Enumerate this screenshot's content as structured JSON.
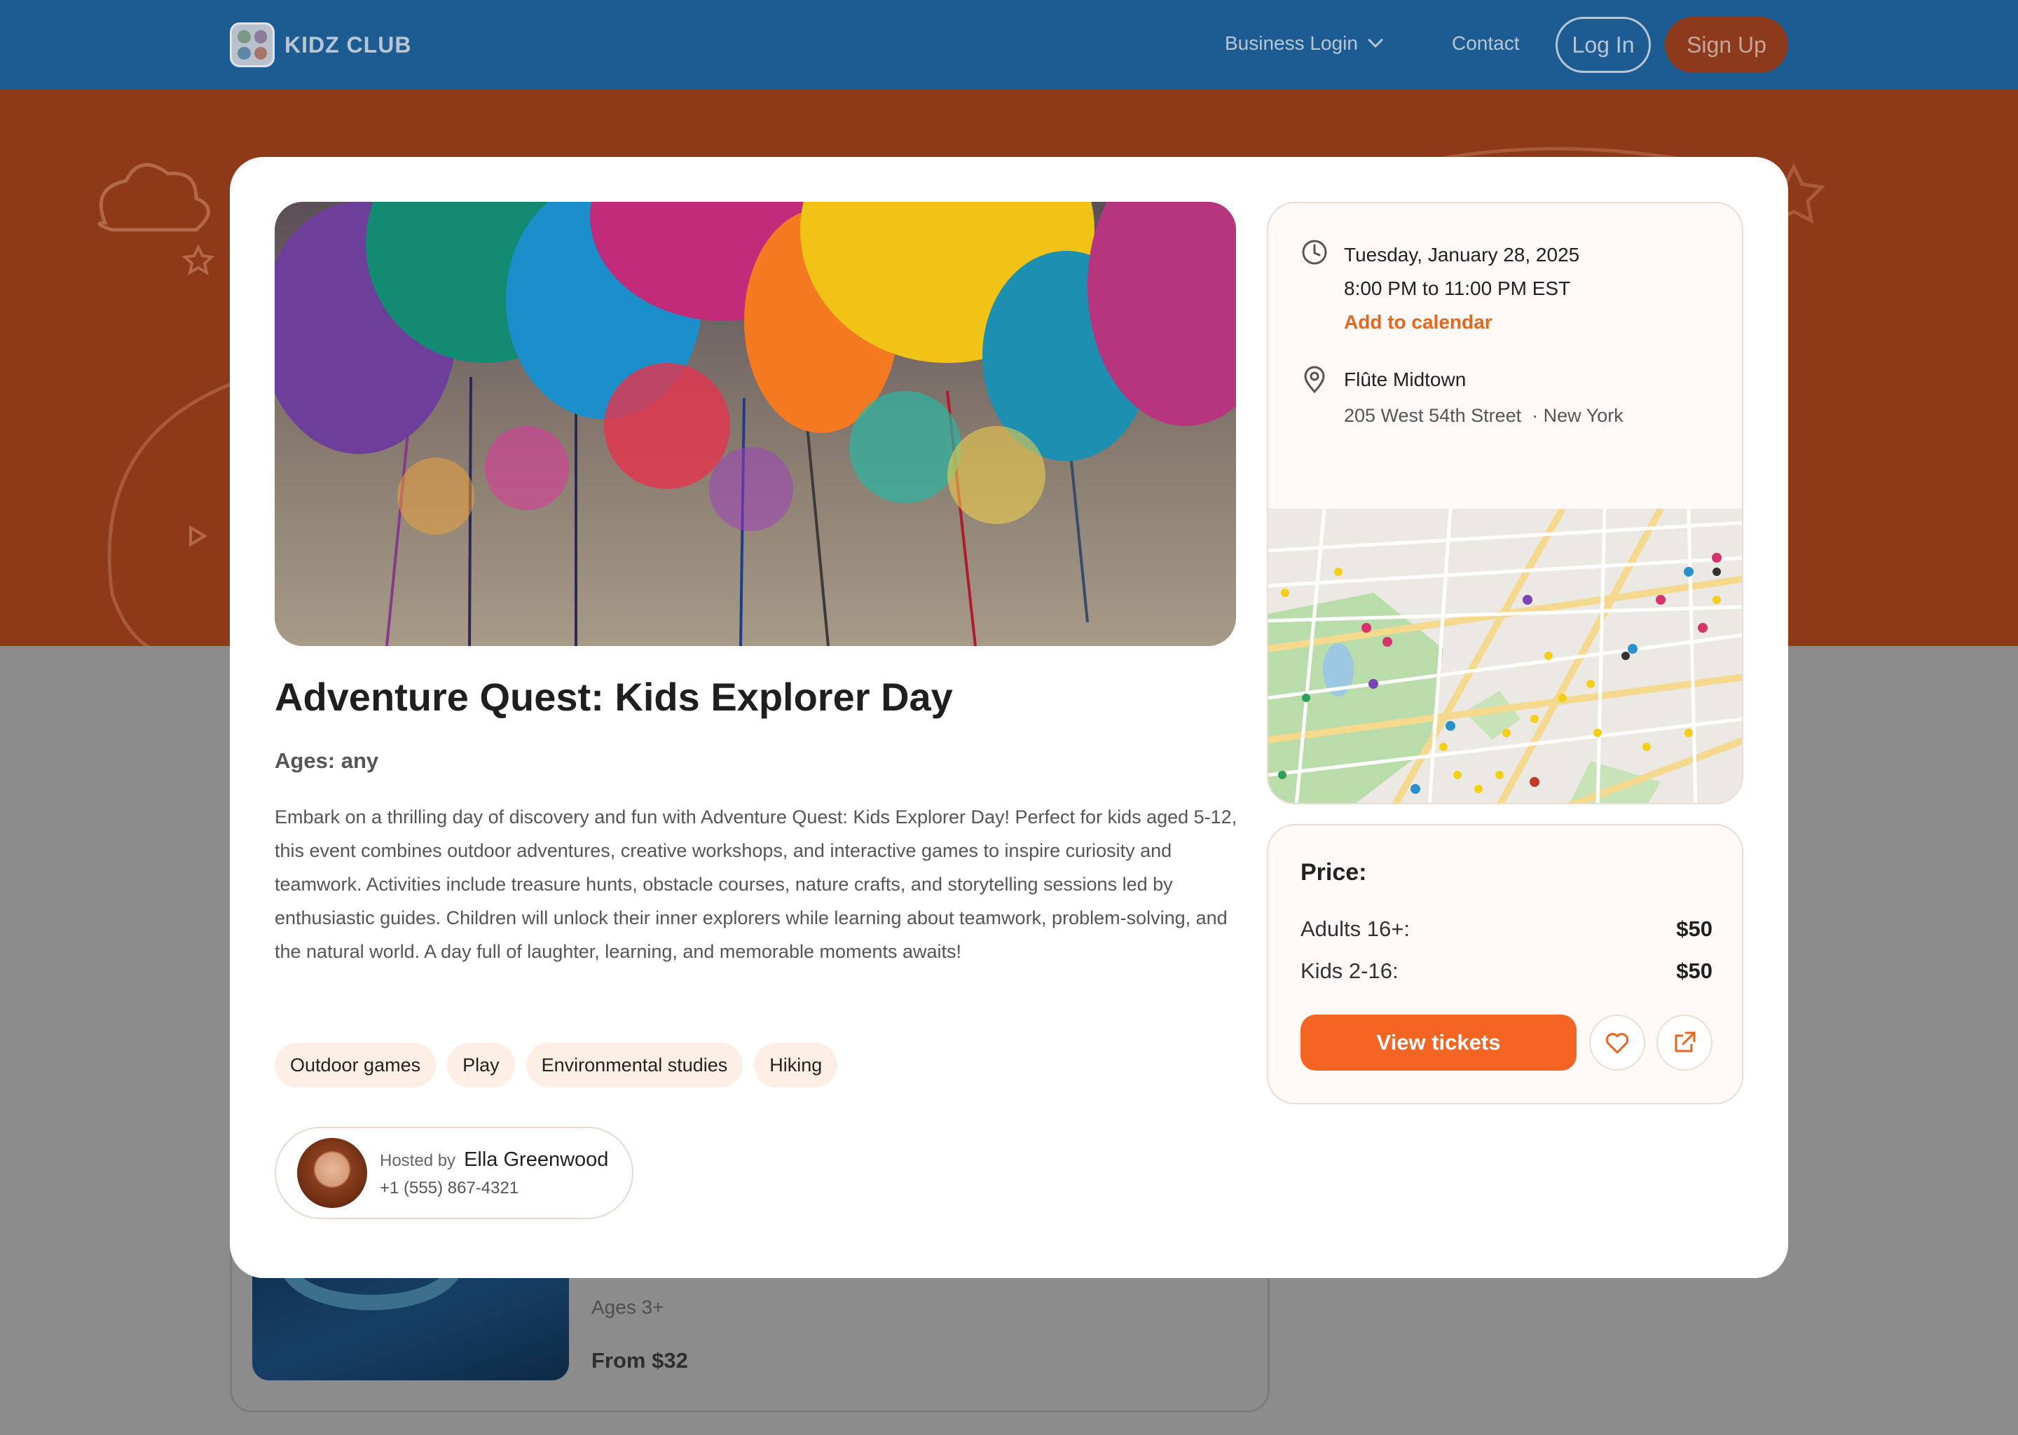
{
  "nav": {
    "brand": "KIDZ CLUB",
    "business_login": "Business Login",
    "contact": "Contact",
    "login": "Log In",
    "signup": "Sign Up"
  },
  "background_card": {
    "ages": "Ages 3+",
    "price": "From $32"
  },
  "event": {
    "title": "Adventure Quest: Kids Explorer Day",
    "ages": "Ages: any",
    "description": "Embark on a thrilling day of discovery and fun with Adventure Quest: Kids Explorer Day! Perfect for kids aged 5-12, this event combines outdoor adventures, creative workshops, and interactive games to inspire curiosity and teamwork. Activities include treasure hunts, obstacle courses, nature crafts, and storytelling sessions led by enthusiastic guides. Children will unlock their inner explorers while learning about teamwork, problem-solving, and the natural world. A day full of laughter, learning, and memorable moments awaits!",
    "tags": [
      "Outdoor games",
      "Play",
      "Environmental studies",
      "Hiking"
    ]
  },
  "host": {
    "hosted_by": "Hosted by",
    "name": "Ella Greenwood",
    "phone": "+1 (555) 867-4321"
  },
  "schedule": {
    "date": "Tuesday, January 28, 2025",
    "time": "8:00 PM to 11:00 PM EST",
    "add_to_calendar": "Add to calendar"
  },
  "location": {
    "venue": "Flûte Midtown",
    "address": "205 West 54th Street",
    "city": "· New York"
  },
  "pricing": {
    "title": "Price:",
    "rows": [
      {
        "label": "Adults 16+:",
        "value": "$50"
      },
      {
        "label": "Kids 2-16:",
        "value": "$50"
      }
    ],
    "view_tickets": "View tickets"
  },
  "colors": {
    "nav_bg": "#1d5c93",
    "accent": "#f26522",
    "hero_bg": "#8e3918",
    "tag_bg": "#fdeee6"
  },
  "icons": {
    "clock": "clock-icon",
    "pin": "map-pin-icon",
    "heart": "heart-icon",
    "share": "external-link-icon",
    "chevron": "chevron-down-icon"
  }
}
